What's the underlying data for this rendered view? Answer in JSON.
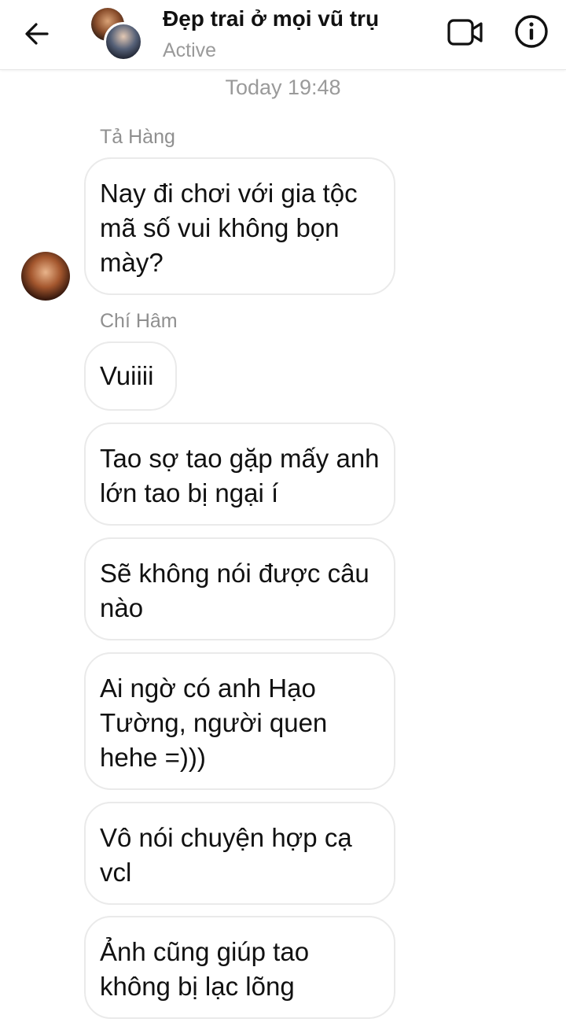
{
  "header": {
    "contact_name": "Đẹp trai ở mọi vũ trụ",
    "status": "Active"
  },
  "conversation": {
    "timestamp": "Today 19:48",
    "senders": {
      "first": "Tả Hàng",
      "second": "Chí Hâm"
    },
    "messages": [
      {
        "sender": "Tả Hàng",
        "text": "Nay đi chơi với gia tộc mã số vui không bọn mày?"
      },
      {
        "sender": "Chí Hâm",
        "text": "Vuiiii"
      },
      {
        "sender": "Chí Hâm",
        "text": "Tao sợ tao gặp mấy anh lớn tao bị ngại í"
      },
      {
        "sender": "Chí Hâm",
        "text": "Sẽ không nói được câu nào"
      },
      {
        "sender": "Chí Hâm",
        "text": "Ai ngờ có anh Hạo Tường, người quen hehe =)))"
      },
      {
        "sender": "Chí Hâm",
        "text": "Vô nói chuyện hợp cạ vcl"
      },
      {
        "sender": "Chí Hâm",
        "text": "Ảnh cũng giúp tao không bị lạc lõng"
      }
    ]
  },
  "icons": {
    "back": "arrow-left-icon",
    "video": "video-camera-icon",
    "info": "info-icon"
  },
  "colors": {
    "bubble_border": "#eaeaea",
    "muted_text": "#9a9a9a",
    "text": "#111111"
  }
}
